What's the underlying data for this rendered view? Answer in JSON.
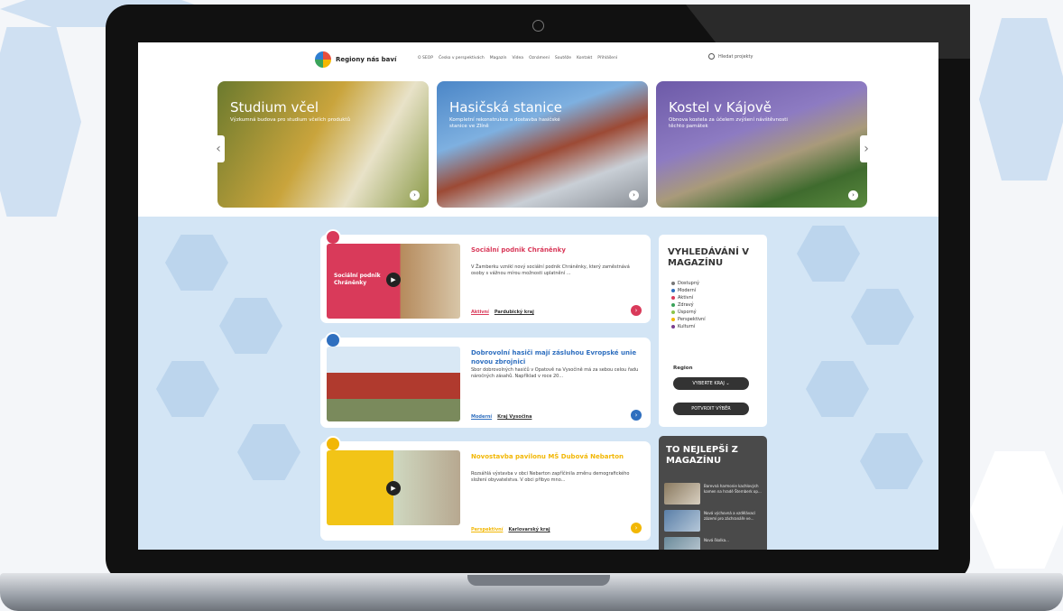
{
  "site": {
    "logo_text": "Regiony nás baví"
  },
  "nav": {
    "items": [
      "O SEOP",
      "Česko v perspektivách",
      "Magazín",
      "Videa",
      "Oznámení",
      "Soutěže",
      "Kontakt",
      "Přihlášení"
    ],
    "search_label": "Hledat projekty"
  },
  "slides": [
    {
      "title": "Studium včel",
      "text": "Výzkumná budova pro studium včelích produktů"
    },
    {
      "title": "Hasičská stanice",
      "text": "Kompletní rekonstrukce a dostavba hasičské stanice ve Zlíně"
    },
    {
      "title": "Kostel v Kájově",
      "text": "Obnova kostela za účelem zvýšení návštěvnosti těchto památek"
    }
  ],
  "articles": [
    {
      "title": "Sociální podnik Chráněnky",
      "image_caption": "Sociální podnik Chráněnky",
      "text": "V Žamberku vznikl nový sociální podnik Chráněnky, který zaměstnává osoby s vážnou mírou možnosti uplatnění ...",
      "tags": [
        "Aktivní",
        "Pardubický kraj"
      ],
      "color": "#d93a5a"
    },
    {
      "title": "Dobrovolní hasiči mají zásluhou Evropské unie novou zbrojnici",
      "text": "Sbor dobrovolných hasičů v Opatově na Vysočině má za sebou celou řadu náročných zásahů. Například v roce 20...",
      "tags": [
        "Moderní",
        "Kraj Vysočina"
      ],
      "color": "#2f6fbf"
    },
    {
      "title": "Novostavba pavilonu MŠ Dubová Nebarton",
      "text": "Rozsáhlá výstavba v obci Nebarton zapříčinila změnu demografického složení obyvatelstva. V obci přibyo mno...",
      "tags": [
        "Perspektivní",
        "Karlovarský kraj"
      ],
      "color": "#f2b705"
    }
  ],
  "magazine_search": {
    "title": "VYHLEDÁVÁNÍ V MAGAZÍNU",
    "categories": [
      {
        "label": "Dostupný",
        "color": "#777777"
      },
      {
        "label": "Moderní",
        "color": "#2f6fbf"
      },
      {
        "label": "Aktivní",
        "color": "#d93a5a"
      },
      {
        "label": "Zdravý",
        "color": "#3aa35b"
      },
      {
        "label": "Úsporný",
        "color": "#8bc34a"
      },
      {
        "label": "Perspektivní",
        "color": "#f2b705"
      },
      {
        "label": "Kulturní",
        "color": "#7b3f8f"
      }
    ],
    "region_label": "Region",
    "select_label": "VYBERTE KRAJ",
    "confirm_label": "POTVRDIT VÝBĚR"
  },
  "best": {
    "title": "TO NEJLEPŠÍ Z MAGAZÍNU",
    "items": [
      "Barevná harmonie kachlových kamen na hradě Šternberk op...",
      "Nová výchovná a vzdělávací zázemí pro záchranáře ve...",
      "Nová školka..."
    ]
  },
  "colors": {
    "accent": "#d3e5f5"
  }
}
